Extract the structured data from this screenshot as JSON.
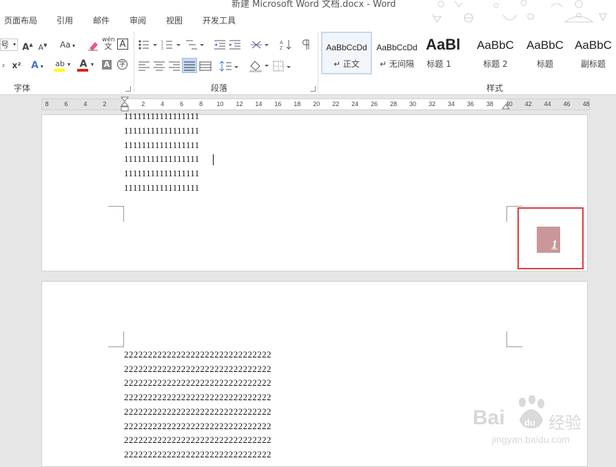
{
  "window": {
    "title": "新建 Microsoft Word 文档.docx - Word"
  },
  "menu": {
    "tabs": [
      "页面布局",
      "引用",
      "邮件",
      "审阅",
      "视图",
      "开发工具"
    ]
  },
  "ribbon": {
    "font_group": {
      "label": "字体",
      "size_suffix": "号",
      "change_case_label": "Aa",
      "phonetic_top": "wén",
      "phonetic_bottom": "文",
      "border_char_label": "A",
      "superscript_label": "x²",
      "font_color_label": "A",
      "highlight_label": "ab",
      "shading_label": "A",
      "enclose_label": "字",
      "grow_label": "A",
      "shrink_label": "A",
      "effects_label": "A"
    },
    "paragraph_group": {
      "label": "段落"
    },
    "styles_group": {
      "label": "样式",
      "items": [
        {
          "preview": "AaBbCcDd",
          "name": "↵ 正文"
        },
        {
          "preview": "AaBbCcDd",
          "name": "↵ 无间隔"
        },
        {
          "preview": "AaBl",
          "name": "标题 1"
        },
        {
          "preview": "AaBbC",
          "name": "标题 2"
        },
        {
          "preview": "AaBbC",
          "name": "标题"
        },
        {
          "preview": "AaBbC",
          "name": "副标题"
        }
      ]
    }
  },
  "ruler": {
    "labels": [
      "8",
      "6",
      "4",
      "2",
      "2",
      "4",
      "6",
      "8",
      "10",
      "12",
      "14",
      "16",
      "18",
      "20",
      "22",
      "24",
      "26",
      "28",
      "30",
      "32",
      "34",
      "36",
      "38",
      "40",
      "42",
      "44",
      "46",
      "48"
    ]
  },
  "document": {
    "page1": {
      "lines": [
        "11111111111111111",
        "11111111111111111",
        "11111111111111111",
        "11111111111111111",
        "11111111111111111",
        "11111111111111111"
      ],
      "page_number": "1"
    },
    "page2": {
      "lines": [
        "2222222222222222222222222222222",
        "2222222222222222222222222222222",
        "2222222222222222222222222222222",
        "2222222222222222222222222222222",
        "2222222222222222222222222222222",
        "2222222222222222222222222222222",
        "2222222222222222222222222222222",
        "2222222222222222222222222222222"
      ]
    }
  },
  "watermark": {
    "brand": "Bai",
    "brand_cn": "经验",
    "url": "jingyan.baidu.com"
  },
  "colors": {
    "highlight_red": "#e03a3a",
    "page_number_bg": "#c9979a",
    "font_color_bar": "#e02020",
    "highlight_bar": "#ffff00"
  }
}
